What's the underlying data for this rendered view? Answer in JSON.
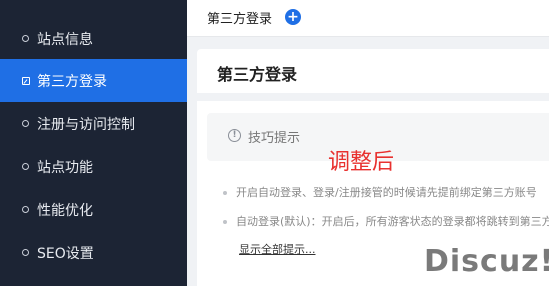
{
  "sidebar": {
    "items": [
      {
        "label": "站点信息",
        "active": false
      },
      {
        "label": "第三方登录",
        "active": true
      },
      {
        "label": "注册与访问控制",
        "active": false
      },
      {
        "label": "站点功能",
        "active": false
      },
      {
        "label": "性能优化",
        "active": false
      },
      {
        "label": "SEO设置",
        "active": false
      }
    ]
  },
  "topbar": {
    "breadcrumb": "第三方登录",
    "add_icon": "plus-circle-icon"
  },
  "card": {
    "title": "第三方登录",
    "tips_title": "技巧提示",
    "tips": [
      "开启自动登录、登录/注册接管的时候请先提前绑定第三方账号",
      "自动登录(默认)：开启后，所有游客状态的登录都将跳转到第三方"
    ],
    "show_all": "显示全部提示..."
  },
  "overlay_text": "调整后",
  "watermark": "Discuz!",
  "colors": {
    "sidebar_bg": "#1c2434",
    "accent": "#1f6fe5",
    "overlay": "#e8312f"
  }
}
